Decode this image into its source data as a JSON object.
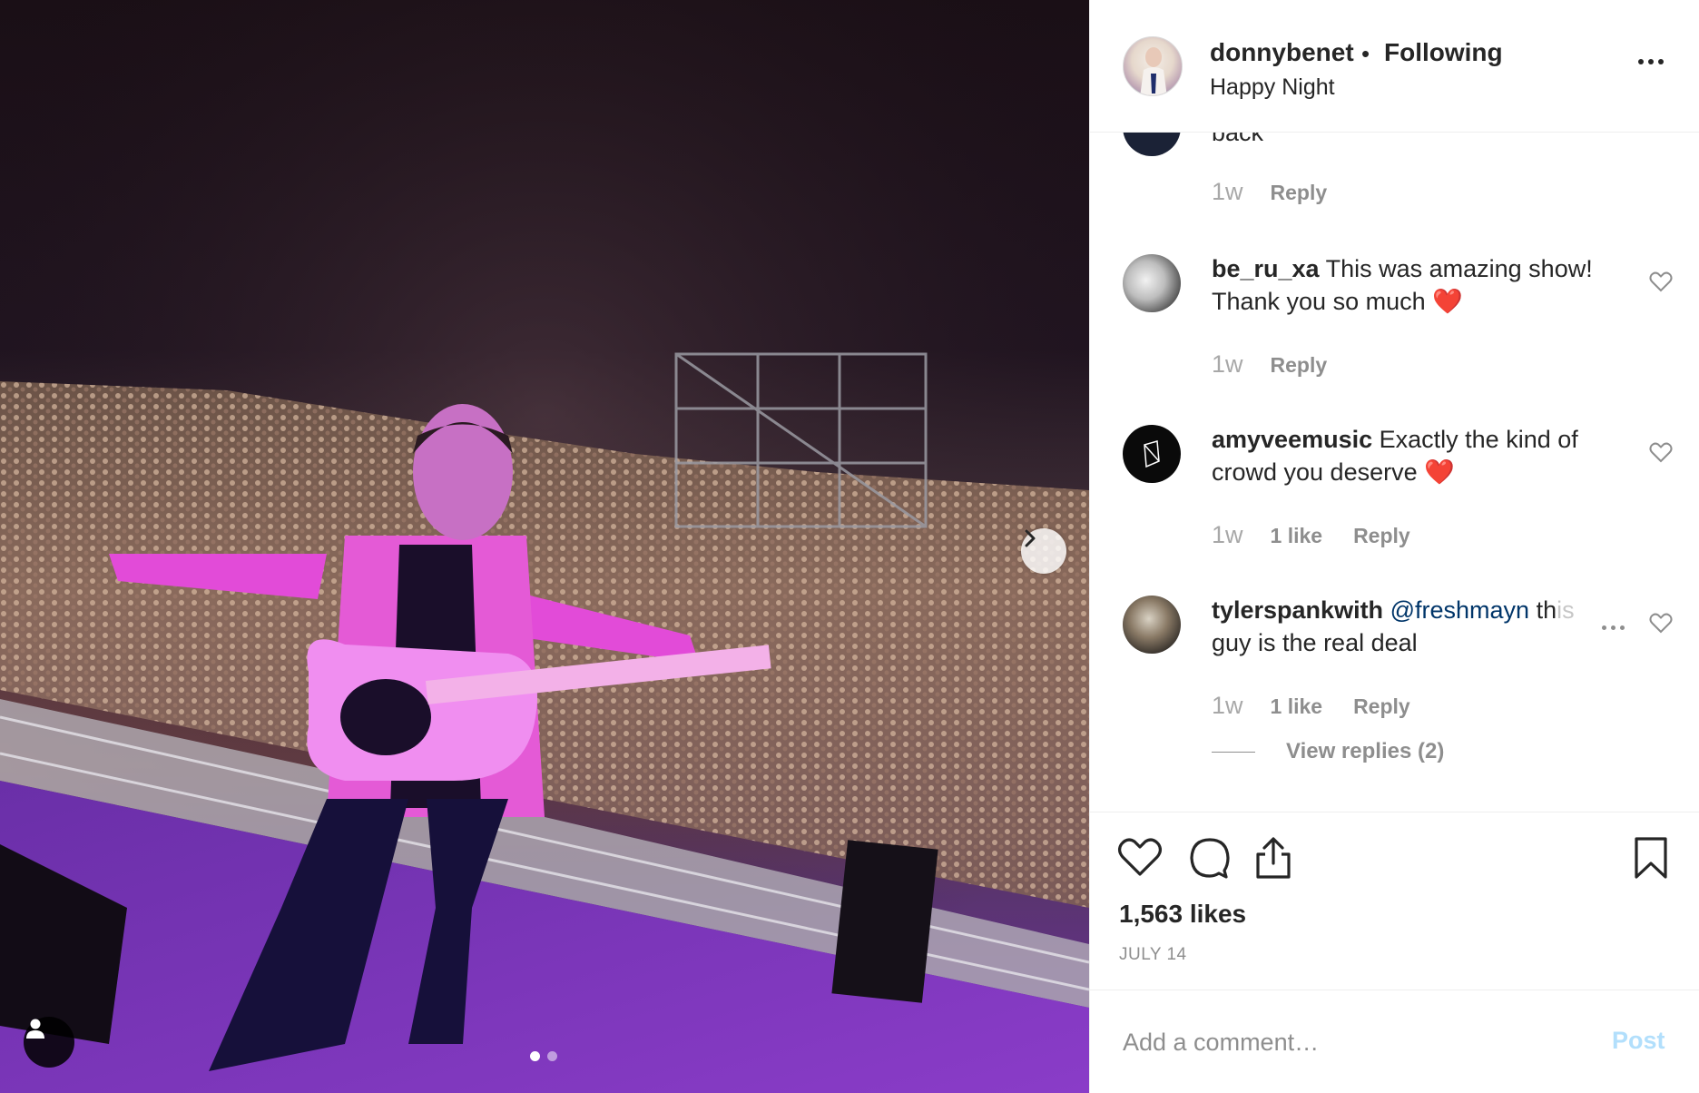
{
  "header": {
    "username": "donnybenet",
    "bullet": "•",
    "follow_status": "Following",
    "location": "Happy Night"
  },
  "comments": [
    {
      "username": "",
      "text": "back",
      "time": "1w",
      "likes": "",
      "reply_label": "Reply",
      "avatar_icon": "avatar"
    },
    {
      "username": "be_ru_xa",
      "text": "This was amazing show! Thank you so much",
      "emoji": "❤️",
      "time": "1w",
      "likes": "",
      "reply_label": "Reply",
      "avatar_icon": "avatar"
    },
    {
      "username": "amyveemusic",
      "text": "Exactly the kind of crowd you deserve",
      "emoji": "❤️",
      "time": "1w",
      "likes": "1 like",
      "reply_label": "Reply",
      "avatar_icon": "avatar"
    },
    {
      "username": "tylerspankwith",
      "mention": "@freshmayn",
      "text_visible": "th",
      "text_faded": "is",
      "text_line2": "guy is the real deal",
      "time": "1w",
      "likes": "1 like",
      "reply_label": "Reply",
      "avatar_icon": "avatar"
    }
  ],
  "view_replies": "View replies (2)",
  "actions": {
    "icons": [
      "heart-icon",
      "comment-icon",
      "share-icon",
      "bookmark-icon"
    ]
  },
  "likes_count": "1,563 likes",
  "post_date": "JULY 14",
  "add_comment": {
    "placeholder": "Add a comment…",
    "post_label": "Post"
  },
  "carousel": {
    "total_slides": 2,
    "active_slide": 1
  },
  "colors": {
    "text": "#262626",
    "secondary": "#8e8e8e",
    "border": "#efefef",
    "link": "#003569",
    "post_disabled": "#b2dffc",
    "heart_emoji": "#ed1c24"
  }
}
